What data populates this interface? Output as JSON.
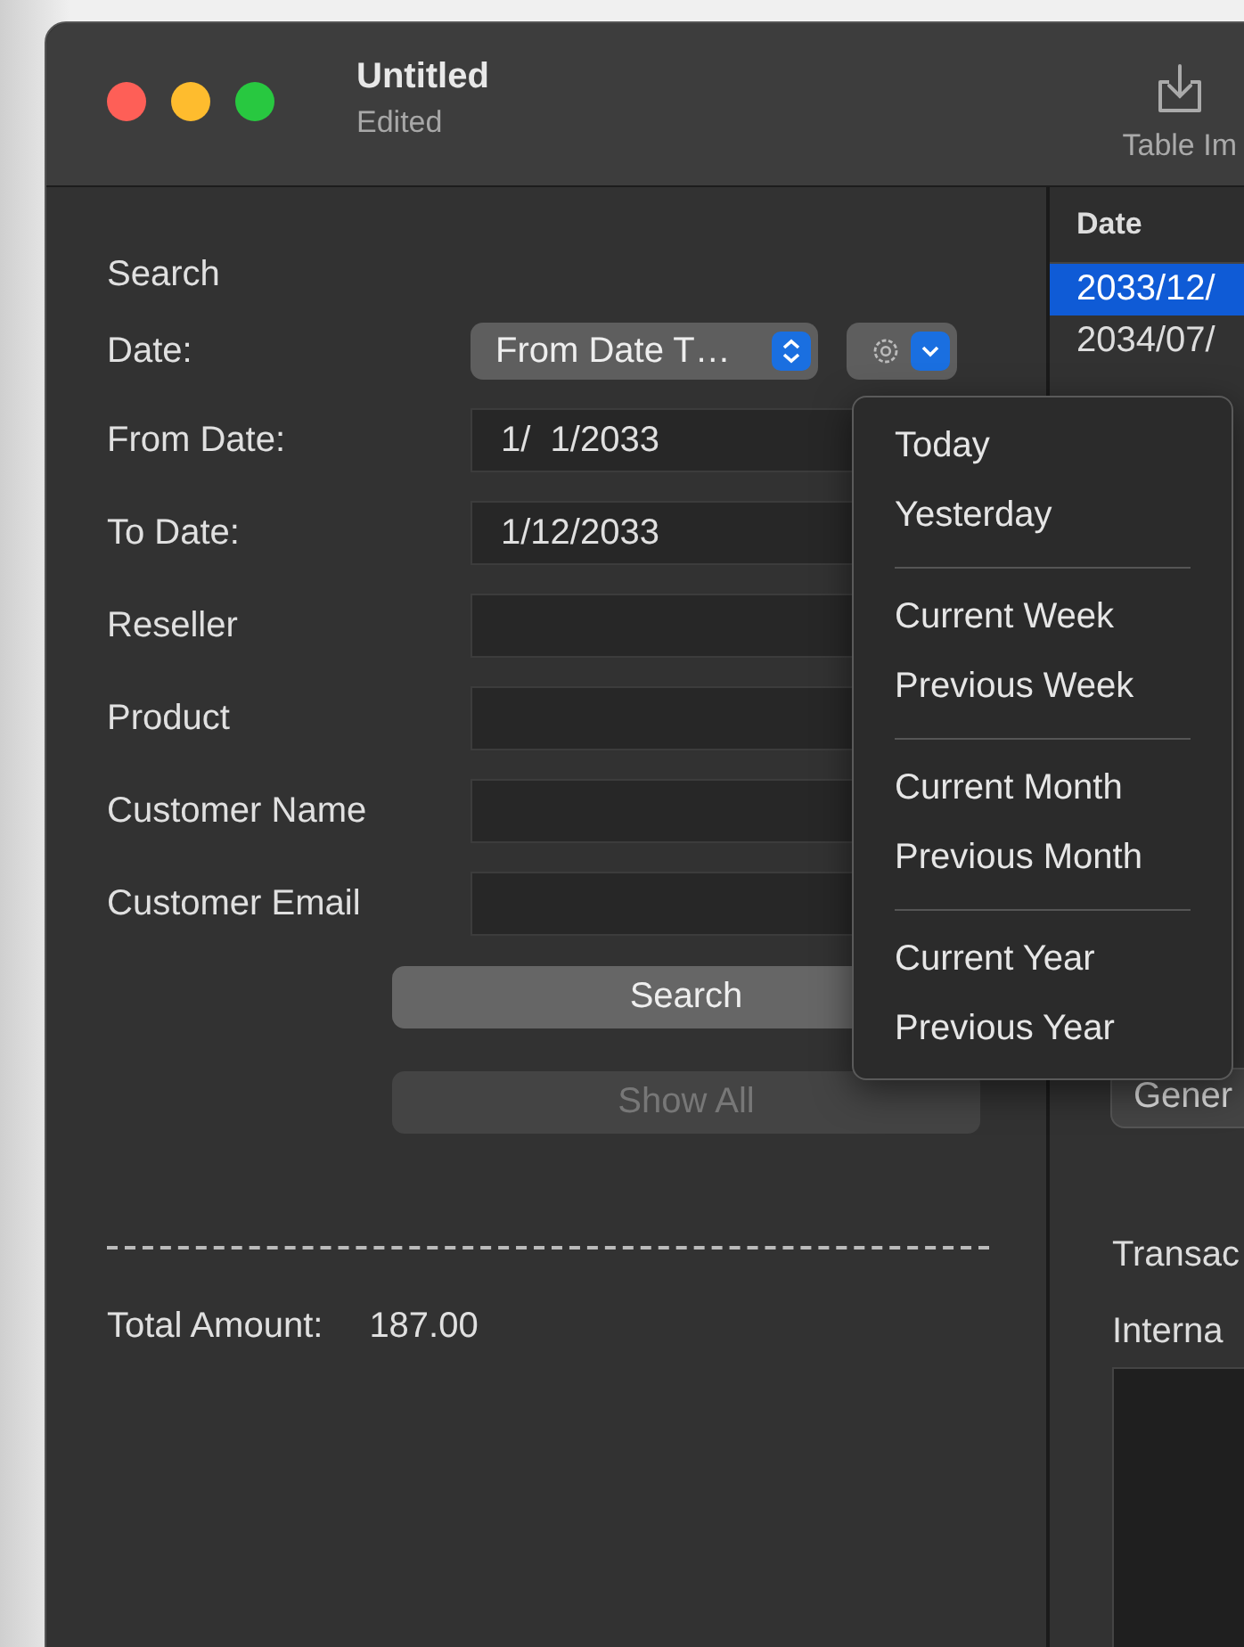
{
  "window": {
    "title": "Untitled",
    "subtitle": "Edited"
  },
  "toolbar": [
    {
      "label": "Table Im"
    }
  ],
  "search_form": {
    "heading": "Search",
    "date_mode": {
      "label": "Date:",
      "value": "From Date T…"
    },
    "fields": [
      {
        "label": "From Date:",
        "value": "1/  1/2033"
      },
      {
        "label": "To Date:",
        "value": "1/12/2033"
      },
      {
        "label": "Reseller"
      },
      {
        "label": "Product"
      },
      {
        "label": "Customer Name"
      },
      {
        "label": "Customer Email"
      }
    ],
    "buttons": [
      {
        "label": "Search",
        "disabled": false
      },
      {
        "label": "Show All",
        "disabled": true
      }
    ],
    "total": {
      "label": "Total Amount:",
      "value": "187.00"
    }
  },
  "date_menu": {
    "groups": [
      [
        "Today",
        "Yesterday"
      ],
      [
        "Current Week",
        "Previous Week"
      ],
      [
        "Current Month",
        "Previous Month"
      ],
      [
        "Current Year",
        "Previous Year"
      ]
    ]
  },
  "table": {
    "columns": [
      "Date"
    ],
    "rows": [
      {
        "cells": [
          "2033/12/"
        ],
        "selected": true
      },
      {
        "cells": [
          "2034/07/"
        ],
        "selected": false
      }
    ]
  },
  "detail": {
    "button": "Gener",
    "labels": [
      "Transac",
      "Interna"
    ]
  }
}
